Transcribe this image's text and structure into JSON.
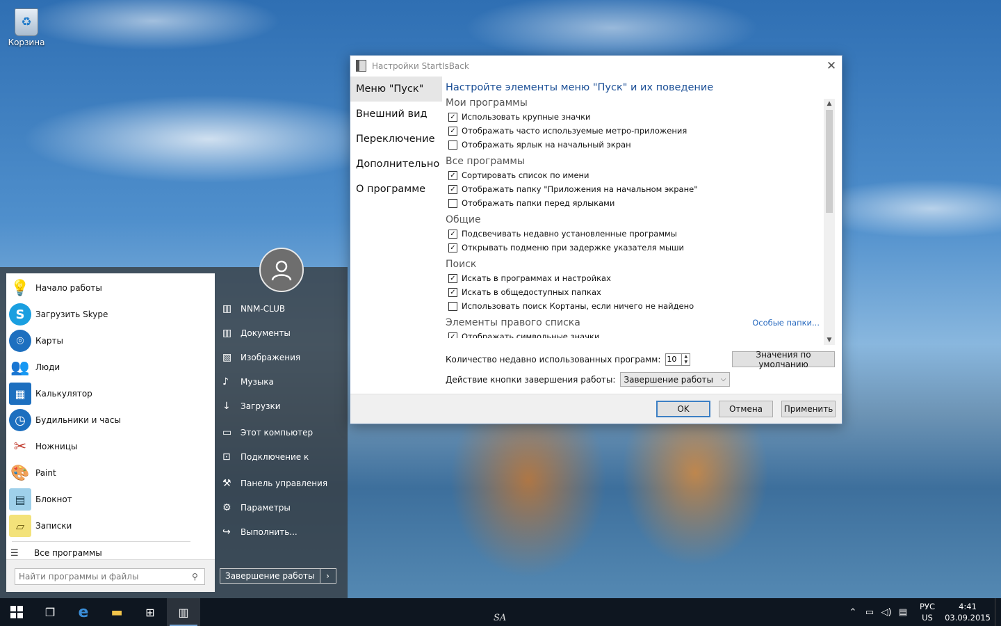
{
  "desktop": {
    "recycle_bin_label": "Корзина"
  },
  "start_menu": {
    "apps": [
      {
        "label": "Начало работы",
        "icon": "lightbulb-icon"
      },
      {
        "label": "Загрузить Skype",
        "icon": "skype-icon"
      },
      {
        "label": "Карты",
        "icon": "maps-icon"
      },
      {
        "label": "Люди",
        "icon": "people-icon"
      },
      {
        "label": "Калькулятор",
        "icon": "calculator-icon"
      },
      {
        "label": "Будильники и часы",
        "icon": "alarm-clock-icon"
      },
      {
        "label": "Ножницы",
        "icon": "scissors-icon"
      },
      {
        "label": "Paint",
        "icon": "paint-palette-icon"
      },
      {
        "label": "Блокнот",
        "icon": "notepad-icon"
      },
      {
        "label": "Записки",
        "icon": "sticky-notes-icon"
      }
    ],
    "all_programs": "Все программы",
    "search_placeholder": "Найти программы и файлы",
    "places": [
      {
        "label": "NNM-CLUB",
        "icon": "user-folder-icon"
      },
      {
        "label": "Документы",
        "icon": "documents-icon"
      },
      {
        "label": "Изображения",
        "icon": "pictures-icon"
      },
      {
        "label": "Музыка",
        "icon": "music-icon"
      },
      {
        "label": "Загрузки",
        "icon": "downloads-icon"
      },
      {
        "label": "Этот компьютер",
        "icon": "computer-icon"
      },
      {
        "label": "Подключение к",
        "icon": "connect-icon"
      },
      {
        "label": "Панель управления",
        "icon": "control-panel-icon"
      },
      {
        "label": "Параметры",
        "icon": "gear-icon"
      },
      {
        "label": "Выполнить...",
        "icon": "run-icon"
      }
    ],
    "shutdown_label": "Завершение работы"
  },
  "window": {
    "title": "Настройки StartIsBack",
    "nav": [
      "Меню \"Пуск\"",
      "Внешний вид",
      "Переключение",
      "Дополнительно",
      "О программе"
    ],
    "heading": "Настройте элементы меню \"Пуск\" и их поведение",
    "sections": [
      {
        "title": "Мои программы",
        "options": [
          {
            "label": "Использовать крупные значки",
            "checked": true
          },
          {
            "label": "Отображать часто используемые метро-приложения",
            "checked": true
          },
          {
            "label": "Отображать ярлык на начальный экран",
            "checked": false
          }
        ]
      },
      {
        "title": "Все программы",
        "options": [
          {
            "label": "Сортировать список по имени",
            "checked": true
          },
          {
            "label": "Отображать папку \"Приложения на начальном экране\"",
            "checked": true
          },
          {
            "label": "Отображать папки перед ярлыками",
            "checked": false
          }
        ]
      },
      {
        "title": "Общие",
        "options": [
          {
            "label": "Подсвечивать недавно установленные программы",
            "checked": true
          },
          {
            "label": "Открывать подменю при задержке указателя мыши",
            "checked": true
          }
        ]
      },
      {
        "title": "Поиск",
        "options": [
          {
            "label": "Искать в программах и настройках",
            "checked": true
          },
          {
            "label": "Искать в общедоступных папках",
            "checked": true
          },
          {
            "label": "Использовать поиск Кортаны, если ничего не найдено",
            "checked": false
          }
        ]
      },
      {
        "title": "Элементы правого списка",
        "link": "Особые папки...",
        "options": [
          {
            "label": "Отображать символьные значки",
            "checked": true
          }
        ]
      }
    ],
    "recent_count_label": "Количество недавно использованных программ:",
    "recent_count_value": "10",
    "defaults_button": "Значения по умолчанию",
    "power_action_label": "Действие кнопки завершения работы:",
    "power_action_value": "Завершение работы",
    "ok_button": "OK",
    "cancel_button": "Отмена",
    "apply_button": "Применить"
  },
  "taskbar": {
    "watermark": "SA",
    "language_top": "РУС",
    "language_bottom": "US",
    "time": "4:41",
    "date": "03.09.2015"
  },
  "colors": {
    "heading": "#1b4f96",
    "link": "#2a6bbf",
    "taskbar": "#0e1620"
  }
}
